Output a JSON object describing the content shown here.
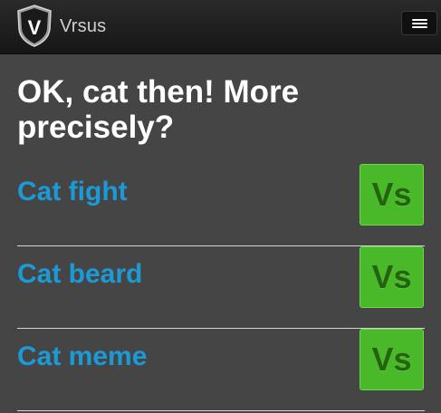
{
  "navbar": {
    "brand": "Vrsus",
    "logo_text": "V",
    "menu_icon": "hamburger-menu-icon"
  },
  "heading": "OK, cat then! More precisely?",
  "items": [
    {
      "label": "Cat fight",
      "vs_label": "Vs"
    },
    {
      "label": "Cat beard",
      "vs_label": "Vs"
    },
    {
      "label": "Cat meme",
      "vs_label": "Vs"
    }
  ],
  "colors": {
    "background": "#454545",
    "navbar": "#1c1c1c",
    "link": "#1a9bd7",
    "vs_button": "#49b829",
    "vs_text": "#24630f"
  }
}
